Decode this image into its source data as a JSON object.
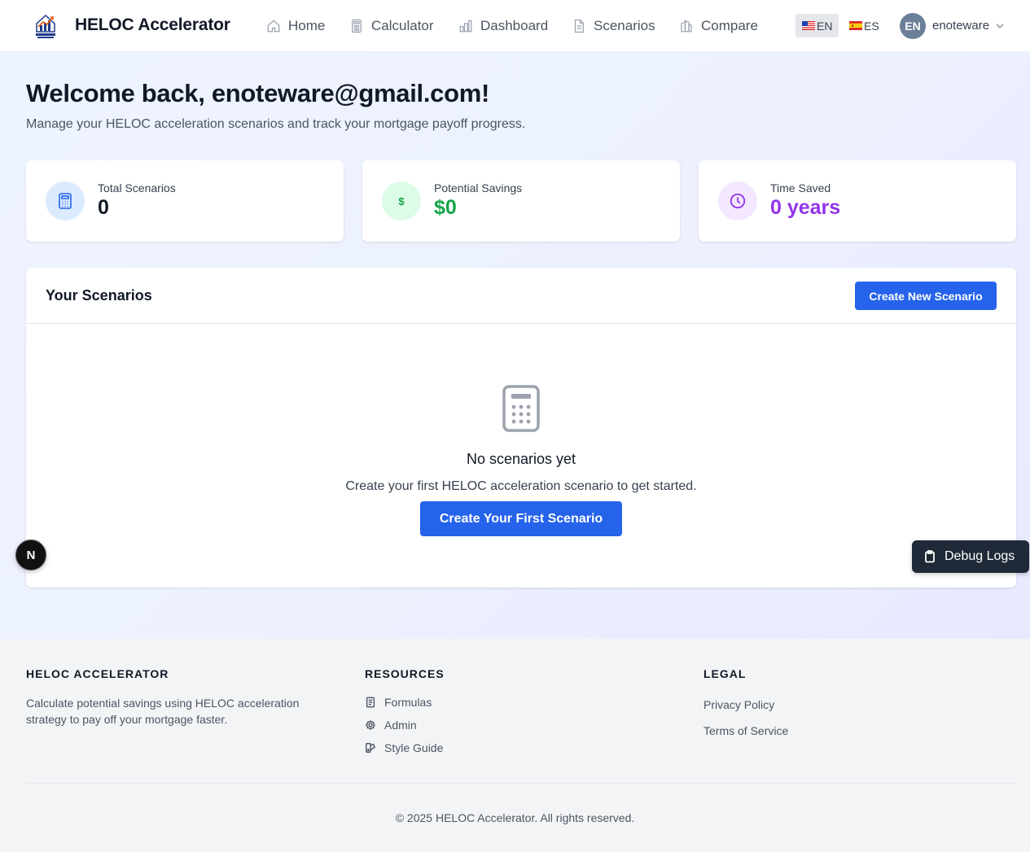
{
  "nav": {
    "brand": "HELOC Accelerator",
    "logo_text": "HELOC Accelerator",
    "items": [
      {
        "label": "Home",
        "icon": "home-icon"
      },
      {
        "label": "Calculator",
        "icon": "calculator-icon"
      },
      {
        "label": "Dashboard",
        "icon": "bar-chart-icon"
      },
      {
        "label": "Scenarios",
        "icon": "document-icon"
      },
      {
        "label": "Compare",
        "icon": "compare-icon"
      }
    ],
    "languages": [
      {
        "code": "EN",
        "flag": "us-flag-icon",
        "active": true
      },
      {
        "code": "ES",
        "flag": "spain-flag-icon",
        "active": false
      }
    ],
    "user": {
      "initials": "EN",
      "name": "enoteware"
    }
  },
  "welcome": {
    "title": "Welcome back, enoteware@gmail.com!",
    "subtitle": "Manage your HELOC acceleration scenarios and track your mortgage payoff progress."
  },
  "stats": [
    {
      "label": "Total Scenarios",
      "value": "0",
      "color": "#111827",
      "icon": "calculator-icon",
      "icon_bg": "#dbeafe"
    },
    {
      "label": "Potential Savings",
      "value": "$0",
      "color": "#16a34a",
      "icon": "dollar-icon",
      "icon_bg": "#dcfce7"
    },
    {
      "label": "Time Saved",
      "value": "0 years",
      "color": "#9333ea",
      "icon": "clock-icon",
      "icon_bg": "#f3e8ff"
    }
  ],
  "scenarios": {
    "title": "Your Scenarios",
    "create_button": "Create New Scenario",
    "empty_title": "No scenarios yet",
    "empty_text": "Create your first HELOC acceleration scenario to get started.",
    "empty_button": "Create Your First Scenario"
  },
  "footer": {
    "col1": {
      "heading": "HELOC ACCELERATOR",
      "description": "Calculate potential savings using HELOC acceleration strategy to pay off your mortgage faster."
    },
    "col2": {
      "heading": "RESOURCES",
      "links": [
        {
          "label": "Formulas",
          "icon": "document-icon"
        },
        {
          "label": "Admin",
          "icon": "gear-icon"
        },
        {
          "label": "Style Guide",
          "icon": "palette-icon"
        }
      ]
    },
    "col3": {
      "heading": "LEGAL",
      "links": [
        {
          "label": "Privacy Policy"
        },
        {
          "label": "Terms of Service"
        }
      ]
    },
    "copyright": "© 2025 HELOC Accelerator. All rights reserved."
  },
  "floating": {
    "next_badge": "N",
    "debug_label": "Debug Logs"
  },
  "colors": {
    "accent": "#2563eb",
    "savings": "#16a34a",
    "time": "#9333ea"
  }
}
